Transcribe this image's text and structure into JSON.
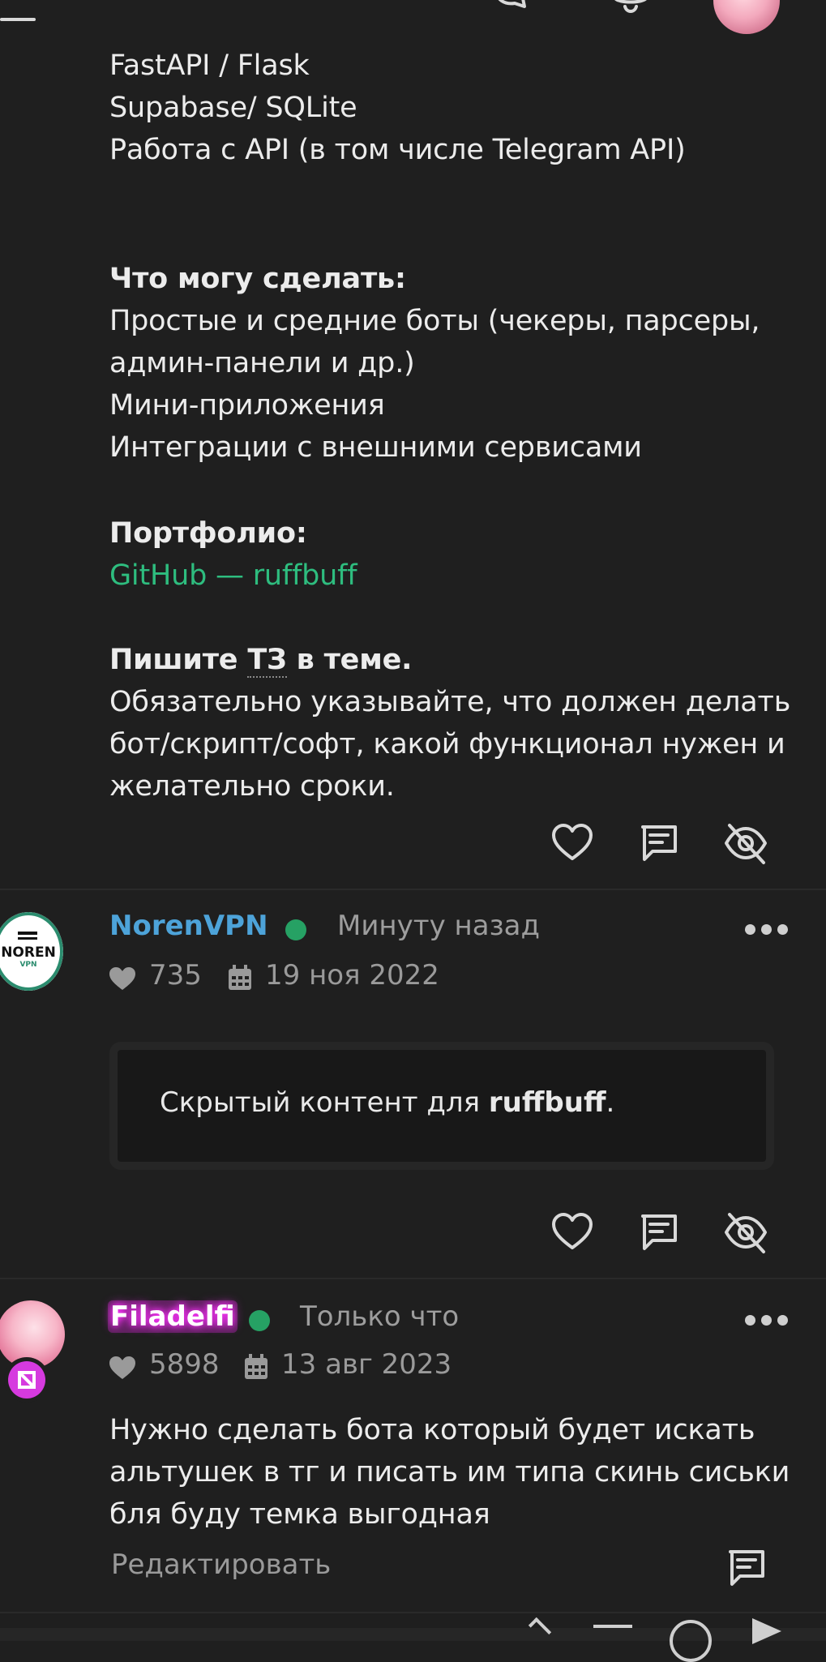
{
  "post1": {
    "lines": [
      "FastAPI / Flask",
      "Supabase/ SQLite",
      "Работа с API (в том числе Telegram API)"
    ],
    "section_can_do": {
      "heading": "Что могу сделать:",
      "items": [
        "Простые и средние боты (чекеры, парсеры,",
        "админ-панели и др.)",
        "Мини-приложения",
        "Интеграции с внешними сервисами"
      ]
    },
    "section_portfolio": {
      "heading": "Портфолио:",
      "link": "GitHub — ruffbuff"
    },
    "section_tz": {
      "heading_before": "Пишите ",
      "heading_abbr": "ТЗ",
      "heading_after": " в теме.",
      "lines": [
        "Обязательно указывайте, что должен делать",
        "бот/скрипт/софт, какой функционал нужен и",
        "желательно сроки."
      ]
    }
  },
  "comment1": {
    "username": "NorenVPN",
    "time": "Минуту назад",
    "likes": "735",
    "joined": "19 ноя 2022",
    "avatar_text": "NOREN",
    "avatar_sub": "VPN",
    "hidden_prefix": "Скрытый контент для ",
    "hidden_user": "ruffbuff",
    "hidden_suffix": "."
  },
  "comment2": {
    "username": "Filadelfi",
    "time": "Только что",
    "likes": "5898",
    "joined": "13 авг 2023",
    "lines": [
      "Нужно сделать бота который будет искать",
      "альтушек в тг и писать им типа скинь сиськи",
      "бля буду темка выгодная"
    ],
    "edit_label": "Редактировать"
  },
  "colors": {
    "background": "#1f1f1f",
    "link_green": "#2ebd7f",
    "username_blue": "#4da3d9",
    "username_magenta": "#ff66ff",
    "online_green": "#26a164"
  },
  "icons": [
    "menu-icon",
    "chat-icon",
    "bell-icon",
    "heart-icon",
    "comment-icon",
    "eye-off-icon",
    "more-icon",
    "calendar-icon"
  ]
}
